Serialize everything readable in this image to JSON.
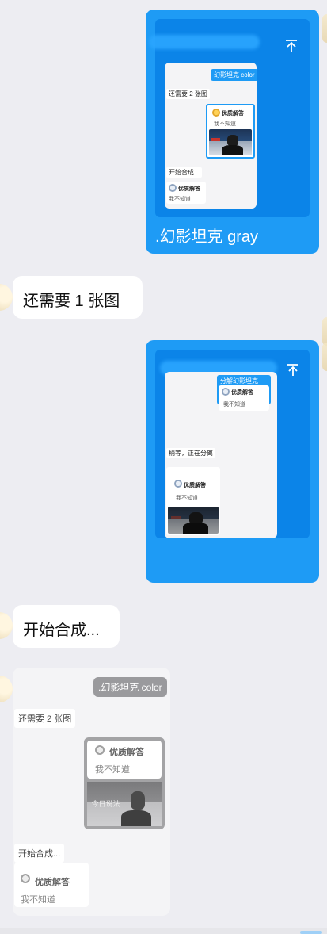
{
  "messages": {
    "m1": {
      "caption": ".幻影坦克 gray",
      "preview": {
        "pill": "幻影坦克 color",
        "text1": "还需要 2 张图",
        "card_title": "优质解答",
        "card_sub": "我不知道",
        "text2": "开始合成...",
        "card2_title": "优质解答",
        "card2_sub": "我不知道"
      }
    },
    "m2": {
      "text": "还需要 1 张图"
    },
    "m3": {
      "preview": {
        "pill": "分解幻影坦克",
        "card_title": "优质解答",
        "card_sub": "我不知道",
        "text1": "稍等，正在分离",
        "card2_title": "优质解答",
        "card2_sub": "我不知道"
      }
    },
    "m4": {
      "text": "开始合成..."
    },
    "m5": {
      "pill": ".幻影坦克 color",
      "text1": "还需要 2 张图",
      "card_title": "优质解答",
      "card_sub": "我不知道",
      "photo_tag": "今日说法",
      "text2": "开始合成...",
      "card2_title": "优质解答",
      "card2_sub": "我不知道"
    }
  },
  "icons": {
    "upload": "arrow-up-to-line-icon",
    "medal": "medal-icon"
  },
  "colors": {
    "accent": "#1e9bf5",
    "background": "#ededf2"
  }
}
